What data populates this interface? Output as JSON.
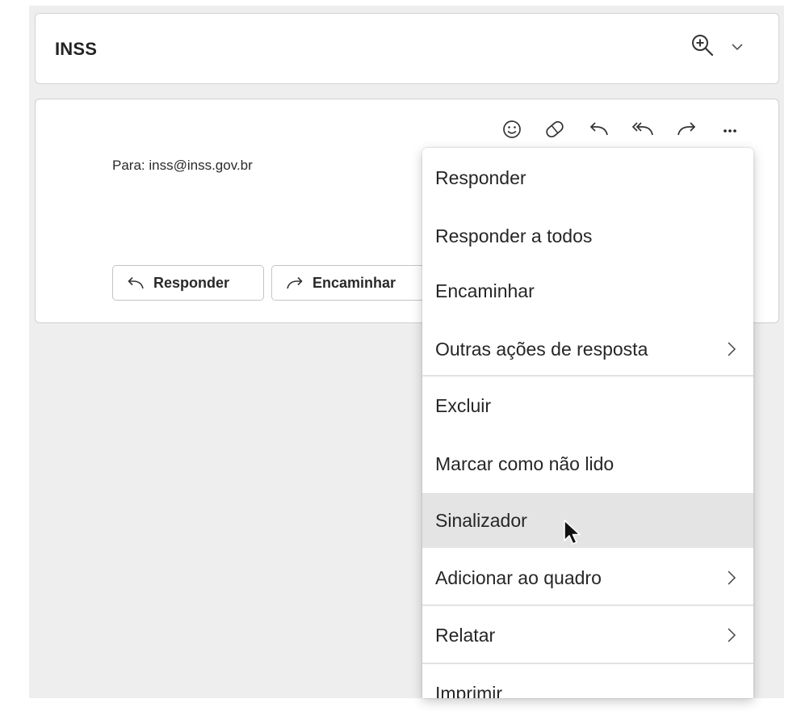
{
  "subject": {
    "title": "INSS"
  },
  "icons": {
    "zoom": "zoom-in-icon",
    "expand": "chevron-down-icon",
    "toolbar": [
      "emoji-icon",
      "sticker-icon",
      "reply-icon",
      "reply-all-icon",
      "forward-icon",
      "more-icon"
    ],
    "cursor": "mouse-pointer-icon"
  },
  "message": {
    "to_line": "Para: inss@inss.gov.br",
    "reply_button": "Responder",
    "forward_button": "Encaminhar"
  },
  "menu": {
    "items": [
      {
        "label": "Responder"
      },
      {
        "label": "Responder a todos"
      },
      {
        "label": "Encaminhar"
      },
      {
        "label": "Outras ações de resposta",
        "submenu": true
      },
      {
        "label": "Excluir"
      },
      {
        "label": "Marcar como não lido"
      },
      {
        "label": "Sinalizador",
        "hovered": true
      },
      {
        "label": "Adicionar ao quadro",
        "submenu": true
      },
      {
        "label": "Relatar",
        "submenu": true
      },
      {
        "label": "Imprimir"
      }
    ]
  },
  "colors": {
    "panel_background": "#eeeeee",
    "hover_background": "#e4e4e4",
    "text": "#262626"
  }
}
